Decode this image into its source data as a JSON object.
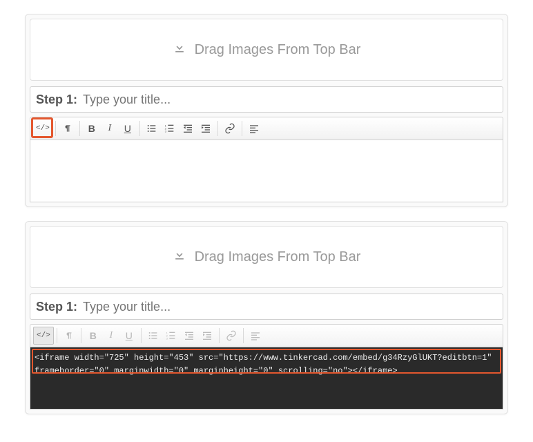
{
  "dragLabel": "Drag Images From Top Bar",
  "stepLabel": "Step 1:",
  "titlePlaceholder": "Type your title...",
  "toolbar": {
    "code": "</>",
    "bold": "B",
    "italic": "I",
    "underline": "U"
  },
  "codeContent": "<iframe width=\"725\" height=\"453\" src=\"https://www.tinkercad.com/embed/g34RzyGlUKT?editbtn=1\" frameborder=\"0\" marginwidth=\"0\" marginheight=\"0\" scrolling=\"no\"></iframe>",
  "colors": {
    "highlight": "#e4572e",
    "codeBg": "#2a2a2a"
  }
}
